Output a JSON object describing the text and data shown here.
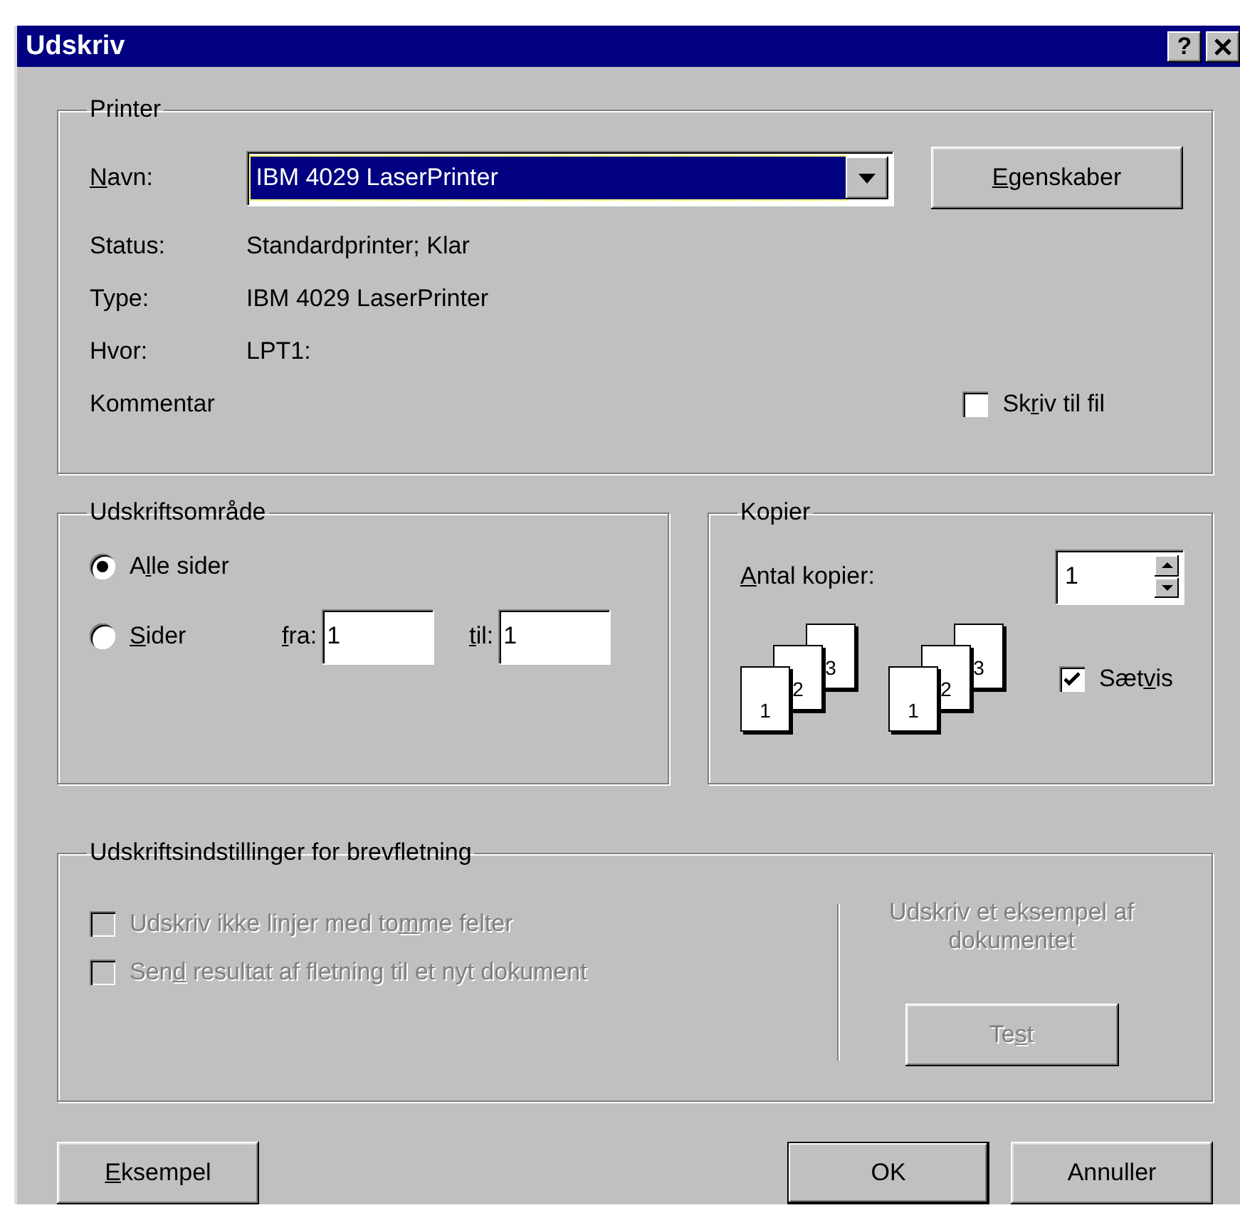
{
  "window": {
    "title": "Udskriv",
    "help_button": "?"
  },
  "printer": {
    "legend": "Printer",
    "name_label": {
      "key": "N",
      "post": "avn:"
    },
    "name_value": "IBM 4029 LaserPrinter",
    "properties_button": {
      "key": "E",
      "post": "genskaber"
    },
    "info": [
      {
        "label": "Status:",
        "value": "Standardprinter; Klar"
      },
      {
        "label": "Type:",
        "value": "IBM 4029 LaserPrinter"
      },
      {
        "label": "Hvor:",
        "value": "LPT1:"
      }
    ],
    "comment_label": "Kommentar",
    "print_to_file": {
      "label": {
        "pre": "Sk",
        "key": "r",
        "post": "iv til fil"
      },
      "checked": false,
      "disabled": false
    }
  },
  "print_range": {
    "legend": "Udskriftsområde",
    "options": [
      {
        "label": {
          "pre": "A",
          "key": "l",
          "post": "le sider"
        },
        "selected": true
      },
      {
        "label": {
          "key": "S",
          "post": "ider"
        },
        "selected": false
      }
    ],
    "from": {
      "label": {
        "key": "f",
        "post": "ra:"
      },
      "value": "1"
    },
    "to": {
      "label": {
        "key": "t",
        "post": "il:"
      },
      "value": "1"
    }
  },
  "copies": {
    "legend": "Kopier",
    "count_label": {
      "key": "A",
      "post": "ntal kopier:"
    },
    "count_value": "1",
    "stacks": [
      [
        "1",
        "2",
        "3"
      ],
      [
        "1",
        "2",
        "3"
      ]
    ],
    "collate": {
      "label": {
        "pre": "Sæt",
        "key": "v",
        "post": "is"
      },
      "checked": true,
      "disabled": false
    }
  },
  "mail_merge": {
    "legend": "Udskriftsindstillinger for brevfletning",
    "options": [
      {
        "label": {
          "pre": "Udskriv ikke linjer med to",
          "key": "m",
          "post": "me felter"
        },
        "checked": false,
        "disabled": true
      },
      {
        "label": {
          "pre": "Sen",
          "key": "d",
          "post": " resultat af fletning til et nyt dokument"
        },
        "checked": false,
        "disabled": true
      }
    ],
    "sample_text": "Udskriv et eksempel af dokumentet",
    "test_button": {
      "label": {
        "pre": "Te",
        "key": "s",
        "post": "t"
      },
      "disabled": true
    }
  },
  "buttons_left": [
    {
      "label": {
        "key": "E",
        "post": "ksempel"
      },
      "default": false
    }
  ],
  "buttons_right": [
    {
      "label": {
        "pre": "OK"
      },
      "default": true
    },
    {
      "label": {
        "pre": "Annuller"
      },
      "default": false
    }
  ]
}
